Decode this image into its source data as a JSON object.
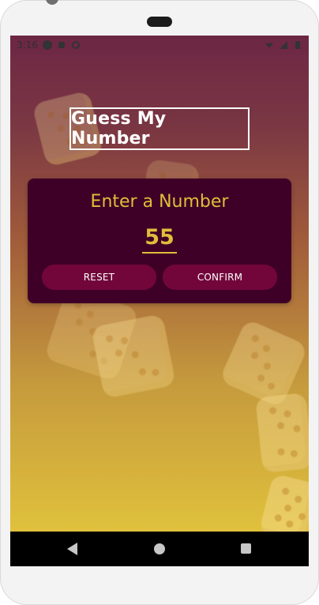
{
  "status_bar": {
    "time": "3:16",
    "icons": [
      "app-icon",
      "app-icon",
      "app-icon",
      "wifi-icon",
      "signal-icon",
      "battery-icon"
    ]
  },
  "header": {
    "title": "Guess My Number"
  },
  "card": {
    "title": "Enter a Number",
    "input_value": "55",
    "reset_label": "RESET",
    "confirm_label": "CONFIRM"
  },
  "navigation": {
    "icons": [
      "back-icon",
      "home-icon",
      "recent-apps-icon"
    ]
  },
  "colors": {
    "accent": "#dfbe3b",
    "card_background": "#3f0027",
    "button_background": "#72063b",
    "title_text": "#ffffff"
  }
}
